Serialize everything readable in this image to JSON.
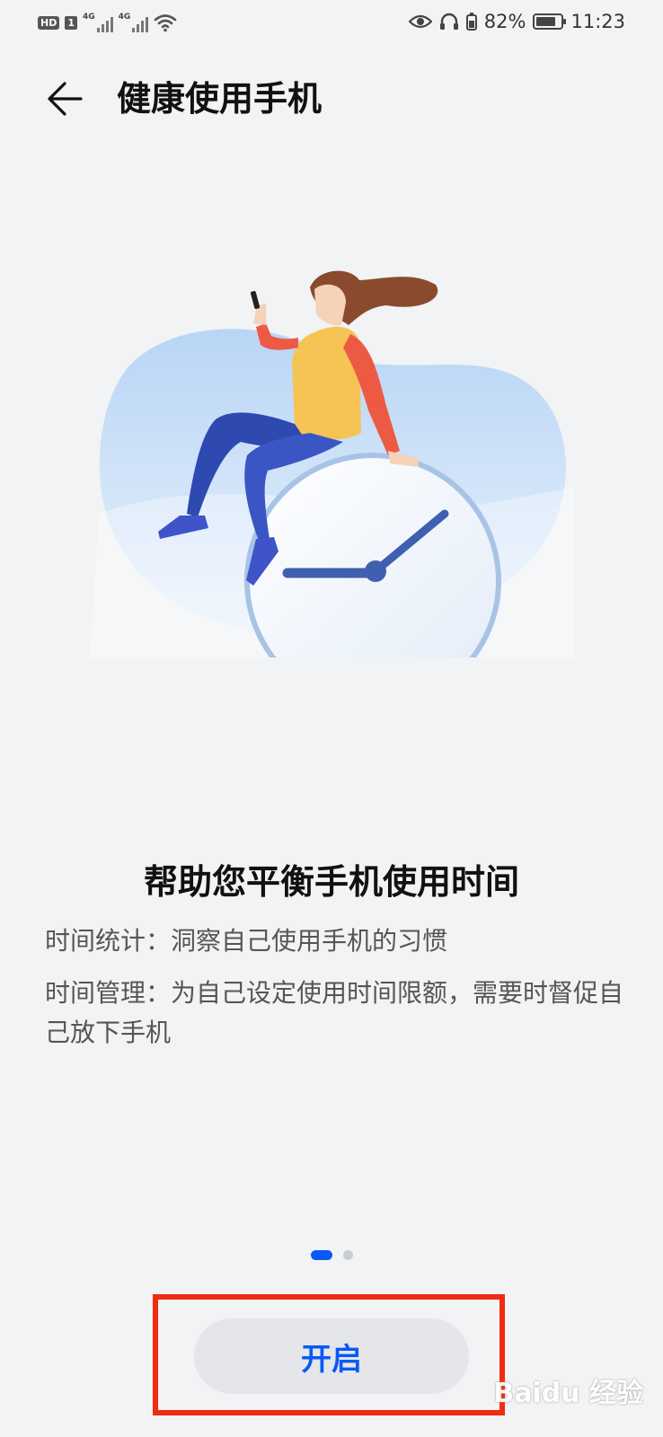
{
  "status_bar": {
    "hd": "HD",
    "sim": "1",
    "net1": "4G",
    "net2": "4G",
    "battery_pct": "82%",
    "battery_level": 0.82,
    "time": "11:23",
    "icons": [
      "signal-icon",
      "wifi-icon",
      "eye-icon",
      "headphones-icon",
      "battery-icon"
    ]
  },
  "header": {
    "title": "健康使用手机"
  },
  "intro": {
    "headline": "帮助您平衡手机使用时间",
    "lines": [
      "时间统计：洞察自己使用手机的习惯",
      "时间管理：为自己设定使用时间限额，需要时督促自己放下手机"
    ]
  },
  "pager": {
    "current": 1,
    "total": 2
  },
  "actions": {
    "enable_label": "开启"
  },
  "watermark": "Baidu 经验",
  "colors": {
    "accent": "#0a59f7",
    "highlight": "#f02b12",
    "background": "#f1f3f5"
  }
}
